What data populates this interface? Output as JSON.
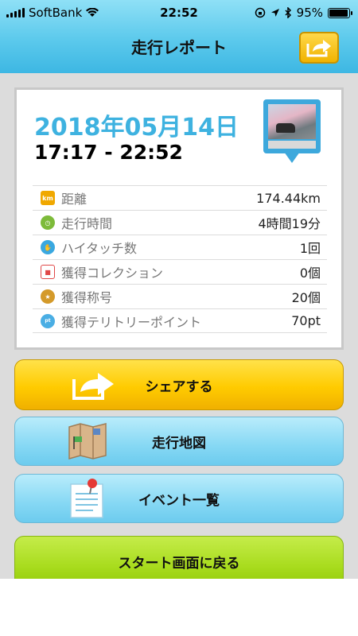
{
  "status": {
    "carrier": "SoftBank",
    "time": "22:52",
    "battery": "95%"
  },
  "header": {
    "title": "走行レポート"
  },
  "report": {
    "date": "2018年05月14日",
    "time_range": "17:17 - 22:52",
    "stats": [
      {
        "icon": "km-icon",
        "label": "距離",
        "value": "174.44km",
        "color": "#f0a800"
      },
      {
        "icon": "clock-icon",
        "label": "走行時間",
        "value": "4時間19分",
        "color": "#7dbb3a"
      },
      {
        "icon": "high-touch-icon",
        "label": "ハイタッチ数",
        "value": "1回",
        "color": "#3aa8e0"
      },
      {
        "icon": "car-collection-icon",
        "label": "獲得コレクション",
        "value": "0個",
        "color": "#e04848"
      },
      {
        "icon": "medal-icon",
        "label": "獲得称号",
        "value": "20個",
        "color": "#d49a2a"
      },
      {
        "icon": "territory-point-icon",
        "label": "獲得テリトリーポイント",
        "value": "70pt",
        "color": "#4aaee4"
      }
    ]
  },
  "buttons": {
    "share": "シェアする",
    "map": "走行地図",
    "events": "イベント一覧",
    "back_to_start": "スタート画面に戻る"
  }
}
